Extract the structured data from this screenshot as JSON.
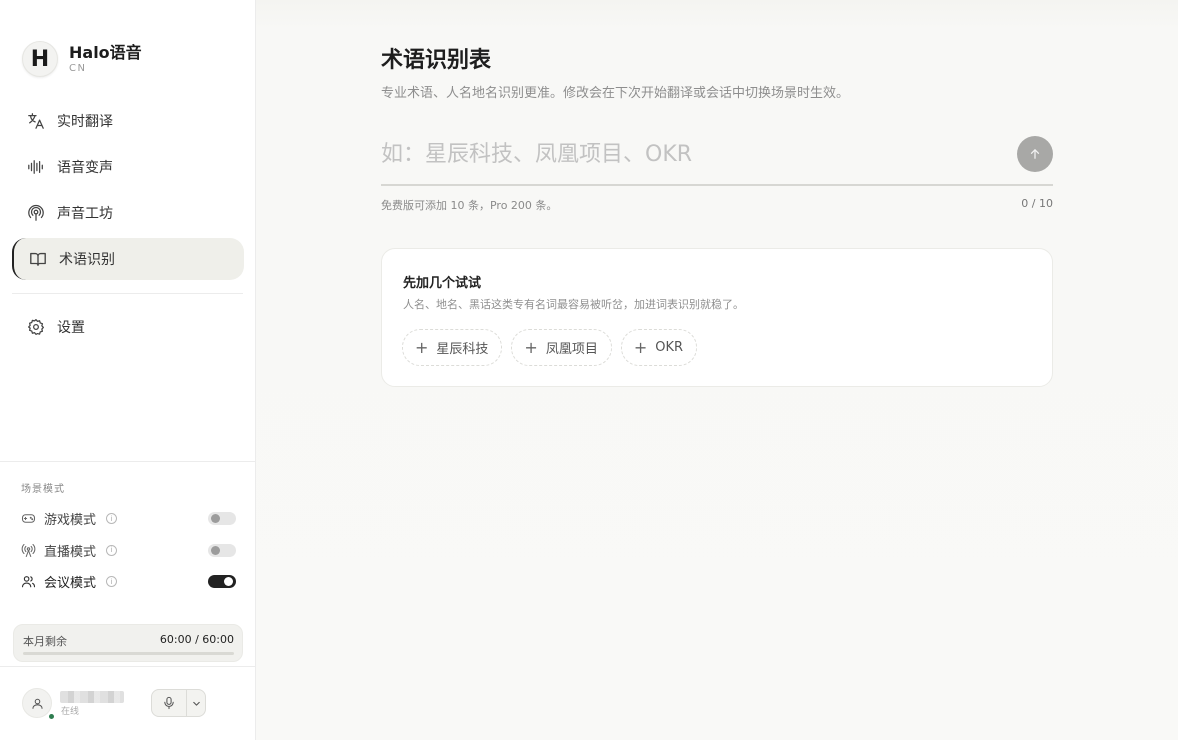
{
  "brand": {
    "logo_letter": "H",
    "name": "Halo语音",
    "sub": "CN"
  },
  "nav": {
    "items": [
      {
        "label": "实时翻译",
        "icon": "translate-icon"
      },
      {
        "label": "语音变声",
        "icon": "waveform-icon"
      },
      {
        "label": "声音工坊",
        "icon": "podcast-icon"
      },
      {
        "label": "术语识别",
        "icon": "book-icon",
        "active": true
      }
    ],
    "settings": {
      "label": "设置",
      "icon": "gear-icon"
    }
  },
  "scene": {
    "title": "场景模式",
    "info_glyph": "i",
    "modes": [
      {
        "label": "游戏模式",
        "icon": "gamepad-icon",
        "enabled": false
      },
      {
        "label": "直播模式",
        "icon": "broadcast-icon",
        "enabled": false
      },
      {
        "label": "会议模式",
        "icon": "users-icon",
        "enabled": true
      }
    ]
  },
  "quota": {
    "label": "本月剩余",
    "value": "60:00 / 60:00",
    "fraction": 1.0
  },
  "user": {
    "status": "在线"
  },
  "main": {
    "title": "术语识别表",
    "subtitle": "专业术语、人名地名识别更准。修改会在下次开始翻译或会话中切换场景时生效。",
    "input": {
      "placeholder": "如：星辰科技、凤凰项目、OKR",
      "value": ""
    },
    "hint": "免费版可添加 10 条，Pro 200 条。",
    "counter": "0 / 10",
    "card": {
      "title": "先加几个试试",
      "subtitle": "人名、地名、黑话这类专有名词最容易被听岔，加进词表识别就稳了。",
      "plus_glyph": "+",
      "chips": [
        "星辰科技",
        "凤凰项目",
        "OKR"
      ]
    }
  },
  "colors": {
    "accent": "#222222",
    "online": "#2e7d4f",
    "submit": "#a8a8a6"
  }
}
